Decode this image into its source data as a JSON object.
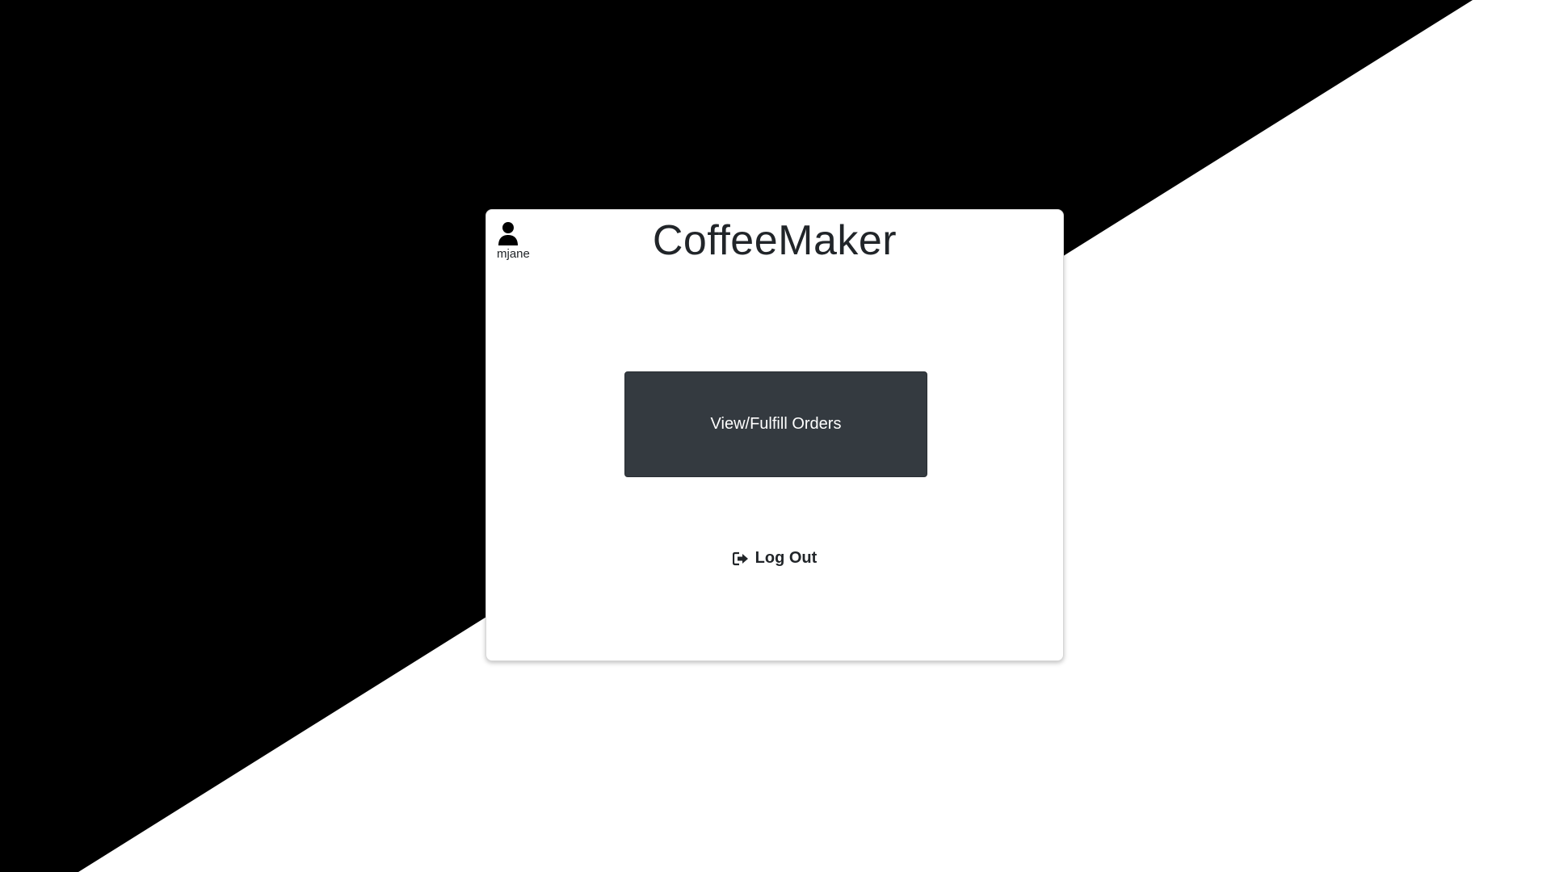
{
  "app": {
    "title": "CoffeeMaker"
  },
  "user": {
    "username": "mjane",
    "icon": "user-icon"
  },
  "actions": {
    "orders_label": "View/Fulfill Orders",
    "logout_label": "Log Out",
    "logout_icon": "sign-out-icon"
  },
  "colors": {
    "background_dark": "#000000",
    "background_light": "#ffffff",
    "button_bg": "#343a40",
    "text": "#212529"
  }
}
